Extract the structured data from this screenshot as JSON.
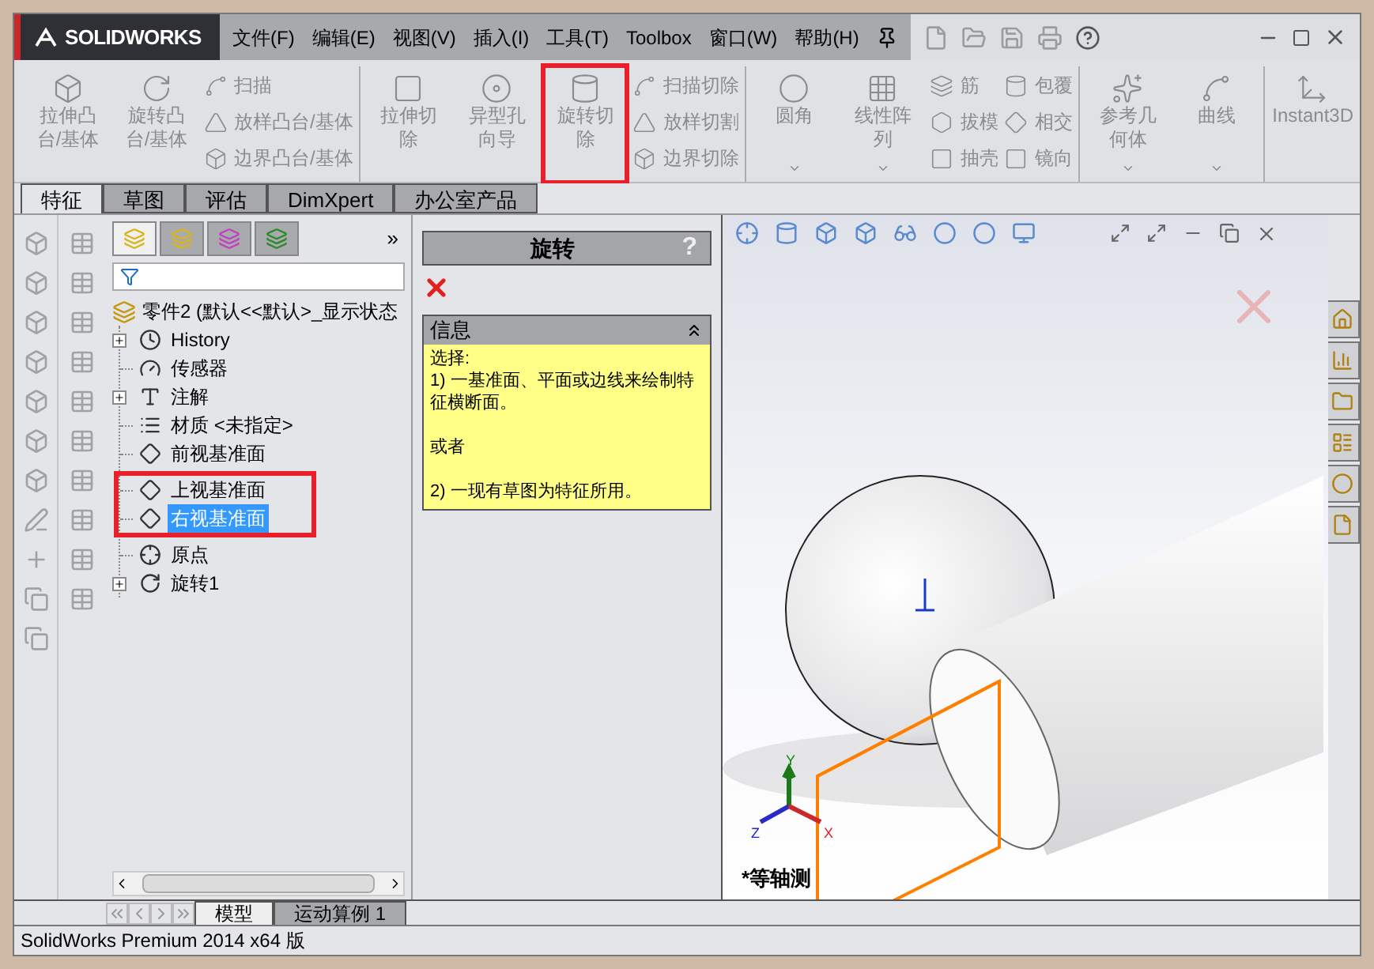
{
  "title_bar": {
    "logo": "SOLIDWORKS",
    "menus": [
      "文件(F)",
      "编辑(E)",
      "视图(V)",
      "插入(I)",
      "工具(T)",
      "Toolbox",
      "窗口(W)",
      "帮助(H)"
    ]
  },
  "ribbon": {
    "groups": [
      {
        "items": [
          {
            "kind": "large",
            "lines": [
              "拉伸凸",
              "台/基体"
            ],
            "dropdown": false,
            "highlighted": false
          },
          {
            "kind": "large",
            "lines": [
              "旋转凸",
              "台/基体"
            ],
            "dropdown": false,
            "highlighted": false
          },
          {
            "kind": "stack",
            "entries": [
              "扫描",
              "放样凸台/基体",
              "边界凸台/基体"
            ]
          }
        ]
      },
      {
        "items": [
          {
            "kind": "large",
            "lines": [
              "拉伸切",
              "除"
            ],
            "dropdown": false,
            "highlighted": false
          },
          {
            "kind": "large",
            "lines": [
              "异型孔",
              "向导"
            ],
            "dropdown": false,
            "highlighted": false
          },
          {
            "kind": "large",
            "lines": [
              "旋转切",
              "除"
            ],
            "dropdown": false,
            "highlighted": true
          },
          {
            "kind": "stack",
            "entries": [
              "扫描切除",
              "放样切割",
              "边界切除"
            ]
          }
        ]
      },
      {
        "items": [
          {
            "kind": "large",
            "lines": [
              "圆角"
            ],
            "dropdown": true,
            "highlighted": false
          },
          {
            "kind": "large",
            "lines": [
              "线性阵",
              "列"
            ],
            "dropdown": true,
            "highlighted": false
          },
          {
            "kind": "stack",
            "entries": [
              "筋",
              "拔模",
              "抽壳"
            ]
          },
          {
            "kind": "stack",
            "entries": [
              "包覆",
              "相交",
              "镜向"
            ]
          }
        ]
      },
      {
        "items": [
          {
            "kind": "large",
            "lines": [
              "参考几",
              "何体"
            ],
            "dropdown": true,
            "highlighted": false
          },
          {
            "kind": "large",
            "lines": [
              "曲线"
            ],
            "dropdown": true,
            "highlighted": false
          }
        ]
      },
      {
        "items": [
          {
            "kind": "large",
            "lines": [
              "Instant3D"
            ],
            "dropdown": false,
            "highlighted": false
          }
        ]
      }
    ]
  },
  "command_tabs": [
    {
      "label": "特征",
      "selected": true
    },
    {
      "label": "草图",
      "selected": false
    },
    {
      "label": "评估",
      "selected": false
    },
    {
      "label": "DimXpert",
      "selected": false
    },
    {
      "label": "办公室产品",
      "selected": false
    }
  ],
  "feature_tree": {
    "panel_tabs": [
      {
        "selected": true
      },
      {
        "selected": false
      },
      {
        "selected": false
      },
      {
        "selected": false
      }
    ],
    "more": "»",
    "root": "零件2  (默认<<默认>_显示状态",
    "items": [
      {
        "kind": "history",
        "label": "History",
        "expander": true,
        "selected": false,
        "highlighted": false
      },
      {
        "kind": "sensor",
        "label": "传感器",
        "expander": false,
        "selected": false,
        "highlighted": false
      },
      {
        "kind": "annotation",
        "label": "注解",
        "expander": true,
        "selected": false,
        "highlighted": false
      },
      {
        "kind": "material",
        "label": "材质 <未指定>",
        "expander": false,
        "selected": false,
        "highlighted": false
      },
      {
        "kind": "plane",
        "label": "前视基准面",
        "expander": false,
        "selected": false,
        "highlighted": false
      },
      {
        "kind": "plane",
        "label": "上视基准面",
        "expander": false,
        "selected": false,
        "highlighted": true
      },
      {
        "kind": "plane",
        "label": "右视基准面",
        "expander": false,
        "selected": true,
        "highlighted": true
      },
      {
        "kind": "origin",
        "label": "原点",
        "expander": false,
        "selected": false,
        "highlighted": false
      },
      {
        "kind": "revolve",
        "label": "旋转1",
        "expander": true,
        "selected": false,
        "highlighted": false
      }
    ]
  },
  "property_manager": {
    "title": "旋转",
    "help": "?",
    "info": {
      "title": "信息",
      "expanded": true,
      "paragraphs": [
        "选择:\n1) 一基准面、平面或边线来绘制特征横断面。",
        "或者",
        "2) 一现有草图为特征所用。"
      ]
    }
  },
  "viewport": {
    "view_label": "*等轴测",
    "triad": {
      "y": "Y",
      "z": "Z",
      "x": "X"
    }
  },
  "bottom_tabs": [
    {
      "label": "模型",
      "selected": true
    },
    {
      "label": "运动算例 1",
      "selected": false
    }
  ],
  "status_bar": "SolidWorks Premium 2014 x64 版"
}
